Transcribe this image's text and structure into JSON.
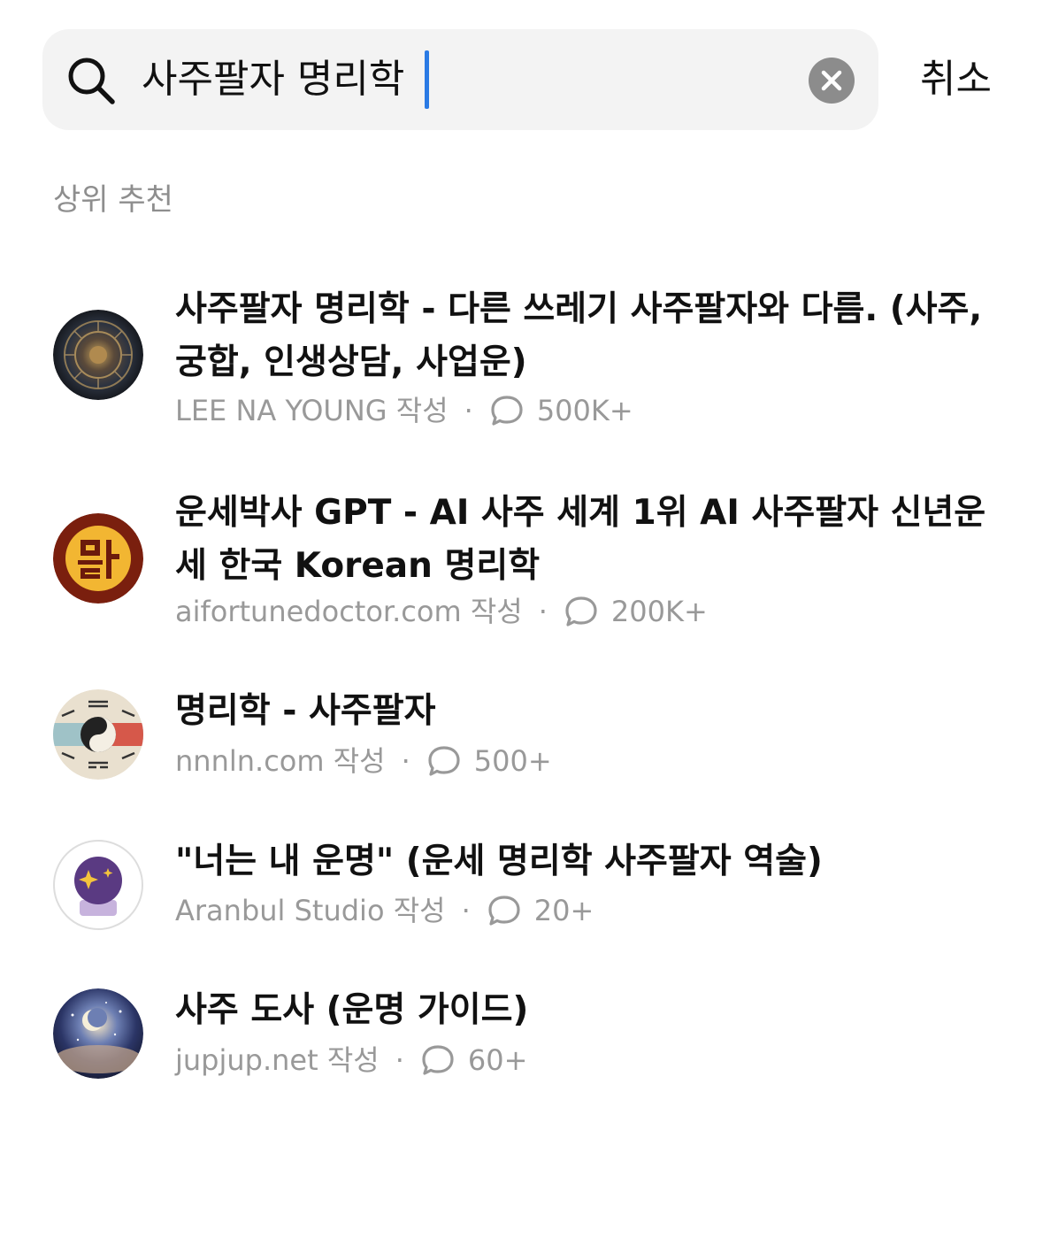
{
  "search": {
    "query": "사주팔자 명리학",
    "cancel_label": "취소"
  },
  "section": {
    "heading": "상위 추천"
  },
  "results": [
    {
      "title": "사주팔자 명리학 - 다른 쓰레기 사주팔자와 다름. (사주, 궁합, 인생상담, 사업운)",
      "author": "LEE NA YOUNG 작성",
      "separator": "·",
      "count": "500K+",
      "avatar_icon": "zodiac-wheel-icon"
    },
    {
      "title": "운세박사 GPT - AI 사주 세계 1위 AI 사주팔자 신년운세 한국 Korean 명리학",
      "author": "aifortunedoctor.com 작성",
      "separator": "·",
      "count": "200K+",
      "avatar_icon": "fortune-doctor-logo-icon"
    },
    {
      "title": "명리학 - 사주팔자",
      "author": "nnnln.com 작성",
      "separator": "·",
      "count": "500+",
      "avatar_icon": "bagua-icon"
    },
    {
      "title": "\"너는 내 운명\" (운세 명리학 사주팔자 역술)",
      "author": "Aranbul Studio 작성",
      "separator": "·",
      "count": "20+",
      "avatar_icon": "crystal-ball-icon"
    },
    {
      "title": "사주 도사 (운명 가이드)",
      "author": "jupjup.net 작성",
      "separator": "·",
      "count": "60+",
      "avatar_icon": "cosmic-moon-icon"
    }
  ]
}
